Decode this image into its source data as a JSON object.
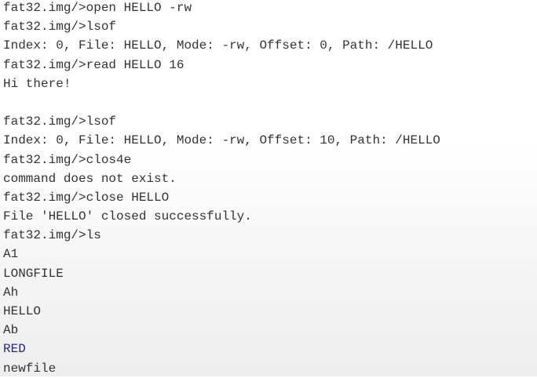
{
  "terminal": {
    "lines": [
      {
        "text": "fat32.img/>open HELLO -rw",
        "kind": "prompt"
      },
      {
        "text": "fat32.img/>lsof",
        "kind": "prompt"
      },
      {
        "text": "Index: 0, File: HELLO, Mode: -rw, Offset: 0, Path: /HELLO",
        "kind": "output"
      },
      {
        "text": "fat32.img/>read HELLO 16",
        "kind": "prompt"
      },
      {
        "text": "Hi there!",
        "kind": "output"
      },
      {
        "text": "",
        "kind": "blank"
      },
      {
        "text": "fat32.img/>lsof",
        "kind": "prompt"
      },
      {
        "text": "Index: 0, File: HELLO, Mode: -rw, Offset: 10, Path: /HELLO",
        "kind": "output"
      },
      {
        "text": "fat32.img/>clos4e",
        "kind": "prompt"
      },
      {
        "text": "command does not exist.",
        "kind": "output"
      },
      {
        "text": "fat32.img/>close HELLO",
        "kind": "prompt"
      },
      {
        "text": "File 'HELLO' closed successfully.",
        "kind": "output"
      },
      {
        "text": "fat32.img/>ls",
        "kind": "prompt"
      },
      {
        "text": "A1",
        "kind": "output"
      },
      {
        "text": "LONGFILE",
        "kind": "output"
      },
      {
        "text": "Ah",
        "kind": "output"
      },
      {
        "text": "HELLO",
        "kind": "output"
      },
      {
        "text": "Ab",
        "kind": "output"
      },
      {
        "text": "RED",
        "kind": "dir"
      },
      {
        "text": "newfile",
        "kind": "output"
      }
    ]
  },
  "colors": {
    "text": "#333333",
    "directory_entry": "#2a2a7a",
    "background": "#ffffff"
  }
}
